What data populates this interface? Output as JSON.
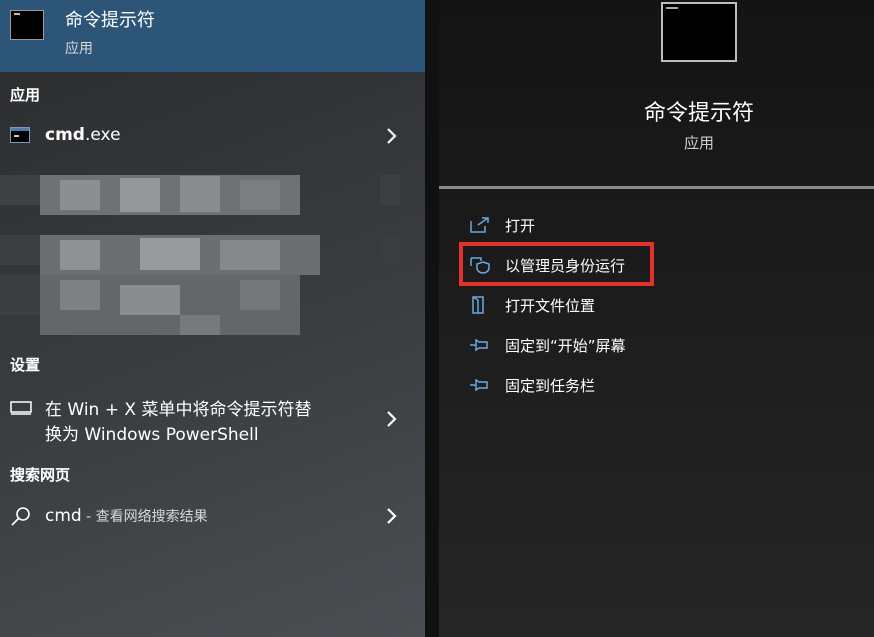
{
  "best_match": {
    "title": "命令提示符",
    "subtitle": "应用"
  },
  "sections": {
    "apps": "应用",
    "settings": "设置",
    "web": "搜索网页"
  },
  "apps": [
    {
      "name_bold": "cmd",
      "name_rest": ".exe"
    }
  ],
  "settings_item": {
    "line1": "在 Win + X 菜单中将命令提示符替",
    "line2": "换为 Windows PowerShell"
  },
  "web_item": {
    "query": "cmd",
    "suffix": " - 查看网络搜索结果"
  },
  "detail": {
    "title": "命令提示符",
    "subtitle": "应用",
    "actions": [
      {
        "label": "打开",
        "icon": "open-icon"
      },
      {
        "label": "以管理员身份运行",
        "icon": "shield-icon"
      },
      {
        "label": "打开文件位置",
        "icon": "file-location-icon"
      },
      {
        "label": "固定到“开始”屏幕",
        "icon": "pin-icon"
      },
      {
        "label": "固定到任务栏",
        "icon": "pin-icon"
      }
    ]
  },
  "colors": {
    "accent": "#2d5577",
    "highlight_box": "#e53030",
    "icon_blue": "#6aa8e0"
  }
}
